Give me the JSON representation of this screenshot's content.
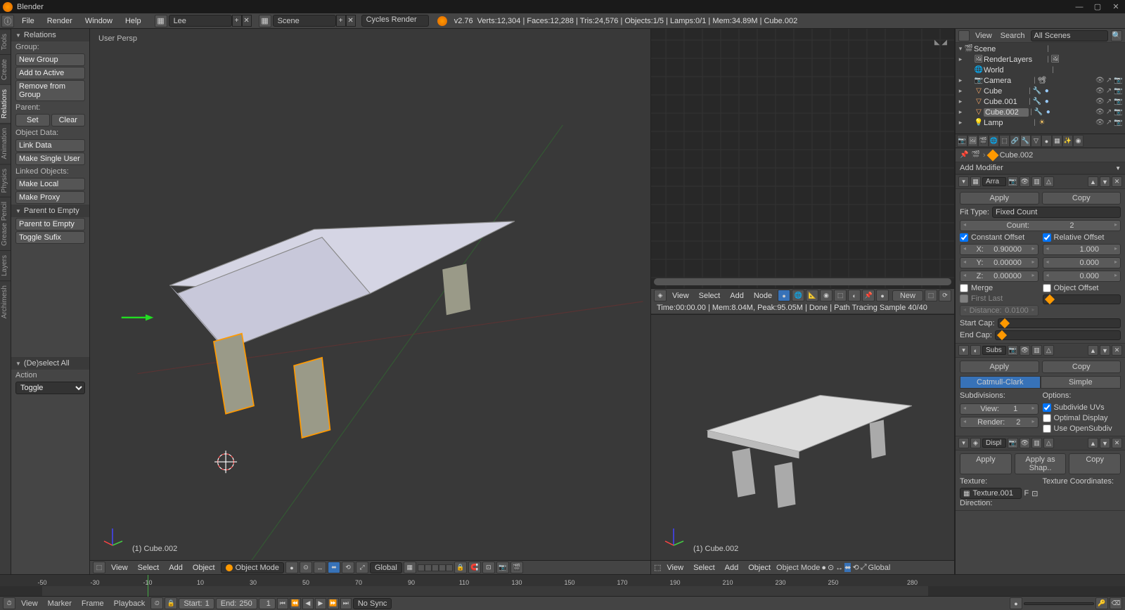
{
  "title": "Blender",
  "menubar": {
    "items": [
      "File",
      "Render",
      "Window",
      "Help"
    ]
  },
  "screen_name": "Lee",
  "scene_name": "Scene",
  "render_engine": "Cycles Render",
  "version": "v2.76",
  "stats": "Verts:12,304 | Faces:12,288 | Tris:24,576 | Objects:1/5 | Lamps:0/1 | Mem:34.89M | Cube.002",
  "left_tabs": [
    "Tools",
    "Create",
    "Relations",
    "Animation",
    "Physics",
    "Grease Pencil",
    "Layers",
    "Archimesh"
  ],
  "toolpanel": {
    "relations": {
      "header": "Relations",
      "group_label": "Group:",
      "new_group": "New Group",
      "add_to_active": "Add to Active",
      "remove_from_group": "Remove from Group",
      "parent_label": "Parent:",
      "set": "Set",
      "clear": "Clear",
      "object_data_label": "Object Data:",
      "link_data": "Link Data",
      "make_single_user": "Make Single User",
      "linked_objects_label": "Linked Objects:",
      "make_local": "Make Local",
      "make_proxy": "Make Proxy"
    },
    "parent_empty": {
      "header": "Parent to Empty",
      "parent_to_empty": "Parent to Empty",
      "toggle_sufix": "Toggle Sufix"
    },
    "deselect": {
      "header": "(De)select All",
      "action_label": "Action",
      "action_value": "Toggle"
    }
  },
  "viewport": {
    "persp_label": "User Persp",
    "obj_label": "(1) Cube.002",
    "menus": [
      "View",
      "Select",
      "Add",
      "Object"
    ],
    "mode": "Object Mode",
    "orientation": "Global"
  },
  "node_editor": {
    "menus": [
      "View",
      "Select",
      "Add",
      "Node"
    ],
    "new_btn": "New",
    "info": "Time:00:00.00 | Mem:8.04M, Peak:95.05M | Done | Path Tracing Sample 40/40",
    "obj_label": "(1) Cube.002",
    "bottom_menus": [
      "View",
      "Select",
      "Add",
      "Object"
    ],
    "bottom_mode": "Object Mode",
    "bottom_orientation": "Global"
  },
  "outliner": {
    "menus": [
      "View",
      "Search"
    ],
    "filter": "All Scenes",
    "tree": [
      {
        "depth": 0,
        "exp": "▾",
        "icon": "scene",
        "name": "Scene",
        "sel": false,
        "toggles": []
      },
      {
        "depth": 1,
        "exp": "▸",
        "icon": "rlayer",
        "name": "RenderLayers",
        "sel": false,
        "extra": "img",
        "toggles": []
      },
      {
        "depth": 1,
        "exp": "",
        "icon": "world",
        "name": "World",
        "sel": false,
        "toggles": []
      },
      {
        "depth": 1,
        "exp": "▸",
        "icon": "cam",
        "name": "Camera",
        "sel": false,
        "extra": "cam",
        "toggles": [
          "eye",
          "cur",
          "rend"
        ]
      },
      {
        "depth": 1,
        "exp": "▸",
        "icon": "mesh",
        "name": "Cube",
        "sel": false,
        "extra": "modmat",
        "toggles": [
          "eye",
          "cur",
          "rend"
        ]
      },
      {
        "depth": 1,
        "exp": "▸",
        "icon": "mesh",
        "name": "Cube.001",
        "sel": false,
        "extra": "modmat",
        "toggles": [
          "eye",
          "cur",
          "rend"
        ]
      },
      {
        "depth": 1,
        "exp": "▸",
        "icon": "mesh",
        "name": "Cube.002",
        "sel": true,
        "extra": "modmat",
        "toggles": [
          "eye",
          "cur",
          "rend"
        ]
      },
      {
        "depth": 1,
        "exp": "▸",
        "icon": "lamp",
        "name": "Lamp",
        "sel": false,
        "extra": "lamp",
        "toggles": [
          "eye",
          "cur",
          "rend"
        ]
      }
    ]
  },
  "breadcrumb_obj": "Cube.002",
  "modifiers": {
    "add_label": "Add Modifier",
    "array": {
      "name": "Arra",
      "apply": "Apply",
      "copy": "Copy",
      "fit_type_label": "Fit Type:",
      "fit_type": "Fixed Count",
      "count_label": "Count:",
      "count": "2",
      "constant_offset": "Constant Offset",
      "relative_offset": "Relative Offset",
      "x_label": "X:",
      "x_const": "0.90000",
      "x_rel": "1.000",
      "y_label": "Y:",
      "y_const": "0.00000",
      "y_rel": "0.000",
      "z_label": "Z:",
      "z_const": "0.00000",
      "z_rel": "0.000",
      "merge": "Merge",
      "first_last": "First Last",
      "distance_label": "Distance:",
      "distance": "0.0100",
      "object_offset": "Object Offset",
      "start_cap": "Start Cap:",
      "end_cap": "End Cap:"
    },
    "subsurf": {
      "name": "Subs",
      "apply": "Apply",
      "copy": "Copy",
      "catmull": "Catmull-Clark",
      "simple": "Simple",
      "subdivisions_label": "Subdivisions:",
      "options_label": "Options:",
      "view_label": "View:",
      "view": "1",
      "render_label": "Render:",
      "render": "2",
      "subdivide_uvs": "Subdivide UVs",
      "optimal_display": "Optimal Display",
      "use_opensubdiv": "Use OpenSubdiv"
    },
    "displace": {
      "name": "Displ",
      "apply": "Apply",
      "apply_as_shape": "Apply as Shap..",
      "copy": "Copy",
      "texture_label": "Texture:",
      "texture": "Texture.001",
      "direction_label": "Direction:",
      "tex_coords_label": "Texture Coordinates:"
    }
  },
  "timeline": {
    "ticks": [
      "-50",
      "-30",
      "-10",
      "10",
      "30",
      "50",
      "70",
      "90",
      "110",
      "130",
      "150",
      "170",
      "190",
      "210",
      "230",
      "250",
      "280"
    ],
    "menus": [
      "View",
      "Marker",
      "Frame",
      "Playback"
    ],
    "start_label": "Start:",
    "start": "1",
    "end_label": "End:",
    "end": "250",
    "current": "1",
    "sync": "No Sync"
  }
}
